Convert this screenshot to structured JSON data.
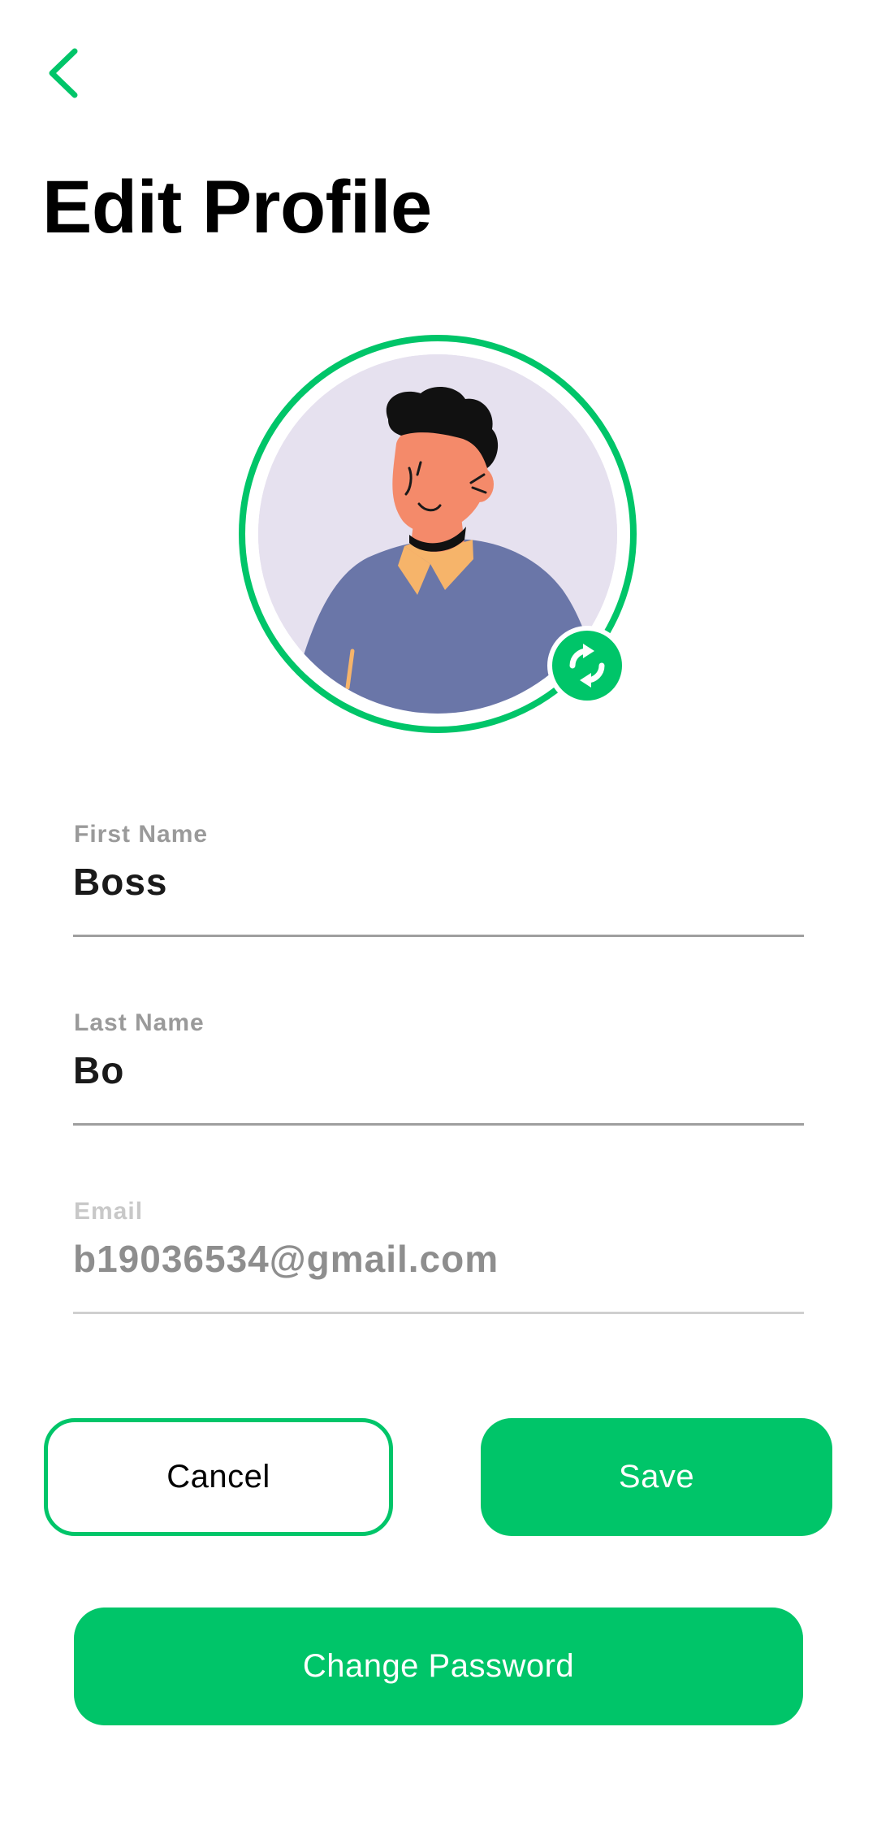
{
  "header": {
    "back_icon": "chevron-left-icon",
    "title": "Edit Profile"
  },
  "avatar": {
    "change_photo_icon": "refresh-icon"
  },
  "form": {
    "first_name": {
      "label": "First Name",
      "value": "Boss"
    },
    "last_name": {
      "label": "Last Name",
      "value": "Bo"
    },
    "email": {
      "label": "Email",
      "value": "b19036534@gmail.com",
      "disabled": true
    }
  },
  "actions": {
    "cancel_label": "Cancel",
    "save_label": "Save",
    "change_password_label": "Change Password"
  },
  "colors": {
    "accent": "#00c569",
    "title": "#000000",
    "label": "#9a9a9a",
    "disabled_text": "#8e8e8e"
  }
}
